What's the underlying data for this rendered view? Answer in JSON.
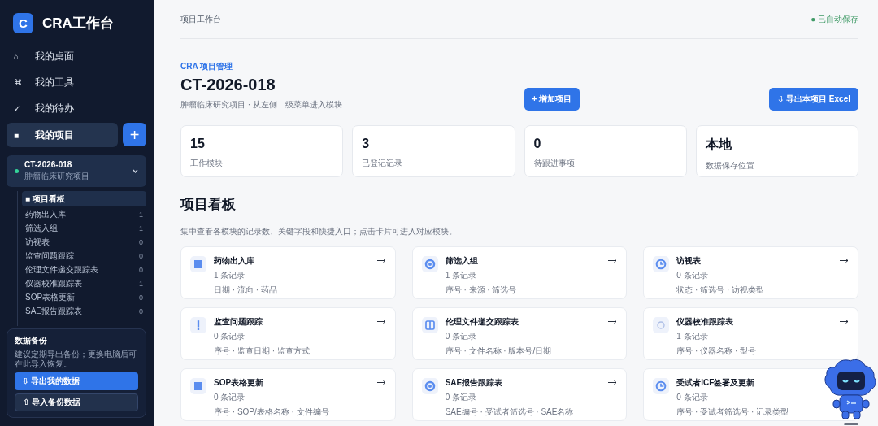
{
  "sidebar": {
    "logo_letter": "C",
    "app_title": "CRA工作台",
    "nav": [
      {
        "icon": "⌂",
        "label": "我的桌面",
        "selected": false
      },
      {
        "icon": "⌘",
        "label": "我的工具",
        "selected": false
      },
      {
        "icon": "✓",
        "label": "我的待办",
        "selected": false
      },
      {
        "icon": "■",
        "label": "我的项目",
        "selected": true
      }
    ],
    "add_button": "+",
    "project": {
      "code": "CT-2026-018",
      "name": "肿瘤临床研究项目",
      "expanded": true
    },
    "modules": [
      {
        "label": "■ 项目看板",
        "selected": true
      },
      {
        "label": "药物出入库",
        "count": "1",
        "selected": false
      },
      {
        "label": "筛选入组",
        "count": "1",
        "selected": false
      },
      {
        "label": "访视表",
        "count": "0",
        "selected": false
      },
      {
        "label": "监查问题跟踪",
        "count": "0",
        "selected": false
      },
      {
        "label": "伦理文件递交跟踪表",
        "count": "0",
        "selected": false
      },
      {
        "label": "仪器校准跟踪表",
        "count": "1",
        "selected": false
      },
      {
        "label": "SOP表格更新",
        "count": "0",
        "selected": false
      },
      {
        "label": "SAE报告跟踪表",
        "count": "0",
        "selected": false
      }
    ],
    "backup": {
      "title": "数据备份",
      "note": "建议定期导出备份；更换电脑后可在此导入恢复。",
      "export_button": "⇩ 导出我的数据",
      "import_button": "⇧ 导入备份数据"
    }
  },
  "topbar": {
    "breadcrumb": "项目工作台",
    "save_status": "● 已自动保存"
  },
  "header": {
    "eyebrow": "CRA 项目管理",
    "title": "CT-2026-018",
    "subtitle": "肿瘤临床研究项目 · 从左侧二级菜单进入模块",
    "add_button": "+ 增加项目",
    "export_button": "⇩ 导出本项目 Excel"
  },
  "stats": [
    {
      "value": "15",
      "label": "工作模块"
    },
    {
      "value": "3",
      "label": "已登记记录"
    },
    {
      "value": "0",
      "label": "待跟进事项"
    },
    {
      "value": "本地",
      "label": "数据保存位置"
    }
  ],
  "board": {
    "title": "项目看板",
    "description": "集中查看各模块的记录数、关键字段和快捷入口；点击卡片可进入对应模块。",
    "cards": [
      {
        "kind": "square",
        "title": "药物出入库",
        "records": "1 条记录",
        "fields": "日期 · 流向 · 药品"
      },
      {
        "kind": "ring",
        "title": "筛选入组",
        "records": "1 条记录",
        "fields": "序号 · 来源 · 筛选号"
      },
      {
        "kind": "clock",
        "title": "访视表",
        "records": "0 条记录",
        "fields": "状态 · 筛选号 · 访视类型"
      },
      {
        "kind": "alert",
        "title": "监查问题跟踪",
        "records": "0 条记录",
        "fields": "序号 · 监查日期 · 监查方式"
      },
      {
        "kind": "columns",
        "title": "伦理文件递交跟踪表",
        "records": "0 条记录",
        "fields": "序号 · 文件名称 · 版本号/日期"
      },
      {
        "kind": "dot",
        "title": "仪器校准跟踪表",
        "records": "1 条记录",
        "fields": "序号 · 仪器名称 · 型号"
      },
      {
        "kind": "square",
        "title": "SOP表格更新",
        "records": "0 条记录",
        "fields": "序号 · SOP/表格名称 · 文件编号"
      },
      {
        "kind": "ring",
        "title": "SAE报告跟踪表",
        "records": "0 条记录",
        "fields": "SAE编号 · 受试者筛选号 · SAE名称"
      },
      {
        "kind": "clock",
        "title": "受试者ICF签署及更新",
        "records": "0 条记录",
        "fields": "序号 · 受试者筛选号 · 记录类型"
      }
    ]
  }
}
